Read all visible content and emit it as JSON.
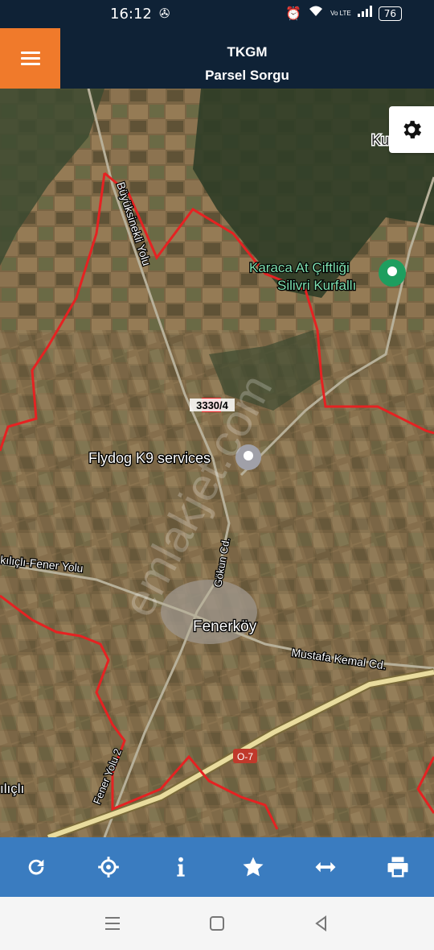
{
  "status_bar": {
    "time": "16:12",
    "battery": "76",
    "network": "Vo LTE"
  },
  "header": {
    "title": "TKGM",
    "subtitle": "Parsel Sorgu"
  },
  "map": {
    "labels": {
      "ku": "Ku",
      "karaca_line1": "Karaca At Çiftliği",
      "karaca_line2": "Silivri Kurfallı",
      "buyuksinekli": "Büyüksinekli Yolu",
      "parcel": "3330/4",
      "flydog": "Flydog K9 services",
      "gokun": "Gökun Cd.",
      "kilicli_fener": "kılıçlı-Fener Yolu",
      "fenerkoy": "Fenerköy",
      "mustafa_kemal": "Mustafa Kemal Cd.",
      "highway": "O-7",
      "fener_yolu_2": "Fener Yolu 2",
      "kilicli": "ılıçlı",
      "watermark": "emlakjet.com"
    },
    "colors": {
      "boundary": "#e52222",
      "poi_green": "#1e9e5f",
      "poi_grey": "#a0a0a8",
      "highway_fill": "#e9dc9e",
      "highway_badge": "#c0392b"
    }
  },
  "toolbar": {
    "icons": [
      "refresh-icon",
      "locate-icon",
      "info-icon",
      "star-icon",
      "measure-icon",
      "print-icon"
    ]
  },
  "navbar": {
    "icons": [
      "recent-apps-icon",
      "home-icon",
      "back-icon"
    ]
  }
}
